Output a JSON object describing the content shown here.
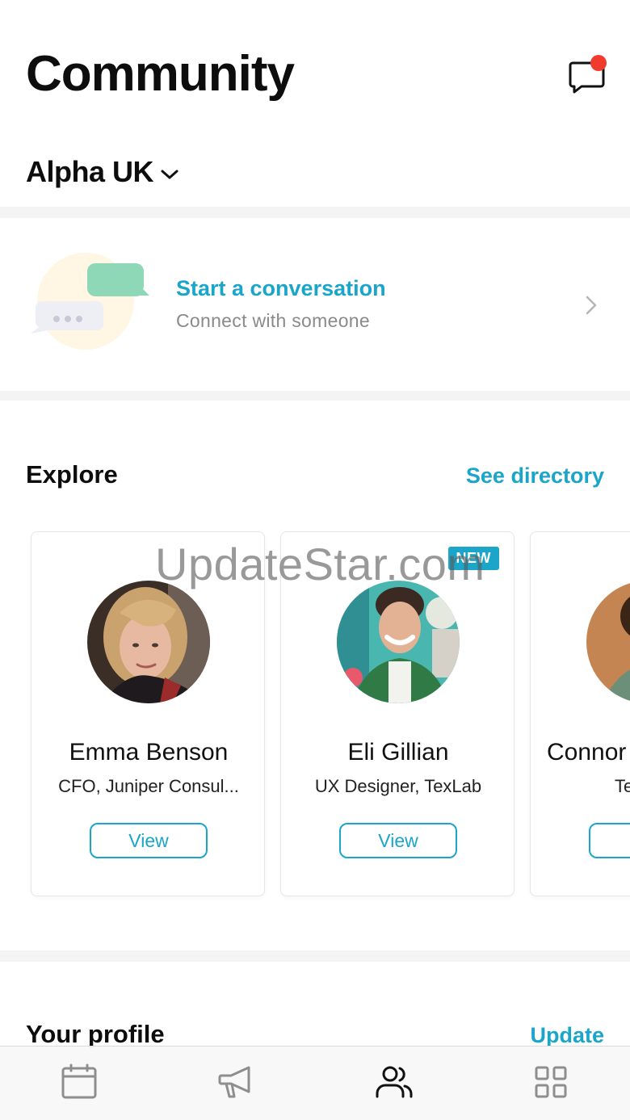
{
  "header": {
    "title": "Community",
    "org_name": "Alpha UK",
    "messages_icon": "chat-bubble-icon",
    "has_notification": true
  },
  "conversation": {
    "title": "Start a conversation",
    "subtitle": "Connect with someone"
  },
  "explore": {
    "title": "Explore",
    "see_directory": "See directory",
    "people": [
      {
        "name": "Emma Benson",
        "role": "CFO, Juniper Consul...",
        "button": "View",
        "badge": ""
      },
      {
        "name": "Eli Gillian",
        "role": "UX Designer, TexLab",
        "button": "View",
        "badge": "NEW"
      },
      {
        "name": "Connor",
        "role": "Te",
        "button": "V",
        "badge": ""
      }
    ]
  },
  "watermark": "UpdateStar.com",
  "profile": {
    "title": "Your profile",
    "update": "Update"
  },
  "tabbar": {
    "items": [
      "calendar-icon",
      "megaphone-icon",
      "people-icon",
      "grid-icon"
    ],
    "active": "people-icon"
  },
  "colors": {
    "accent": "#1aa5c9",
    "notification": "#f13a2e"
  }
}
